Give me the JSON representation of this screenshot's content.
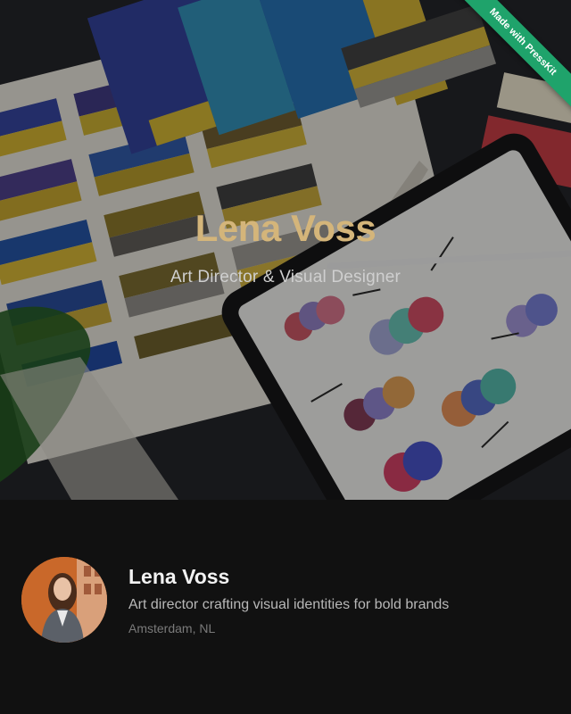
{
  "hero": {
    "title": "Lena Voss",
    "subtitle": "Art Director & Visual Designer",
    "title_color": "#d4b57a",
    "subtitle_color": "#cfcfcf",
    "image_icon": "color-swatch-photo"
  },
  "badge": {
    "label": "Made with PressKit",
    "color": "#1fa36b"
  },
  "profile": {
    "name": "Lena Voss",
    "tagline": "Art director crafting visual identities for bold brands",
    "location": "Amsterdam, NL",
    "avatar_icon": "avatar-photo"
  },
  "colors": {
    "background": "#111111"
  }
}
